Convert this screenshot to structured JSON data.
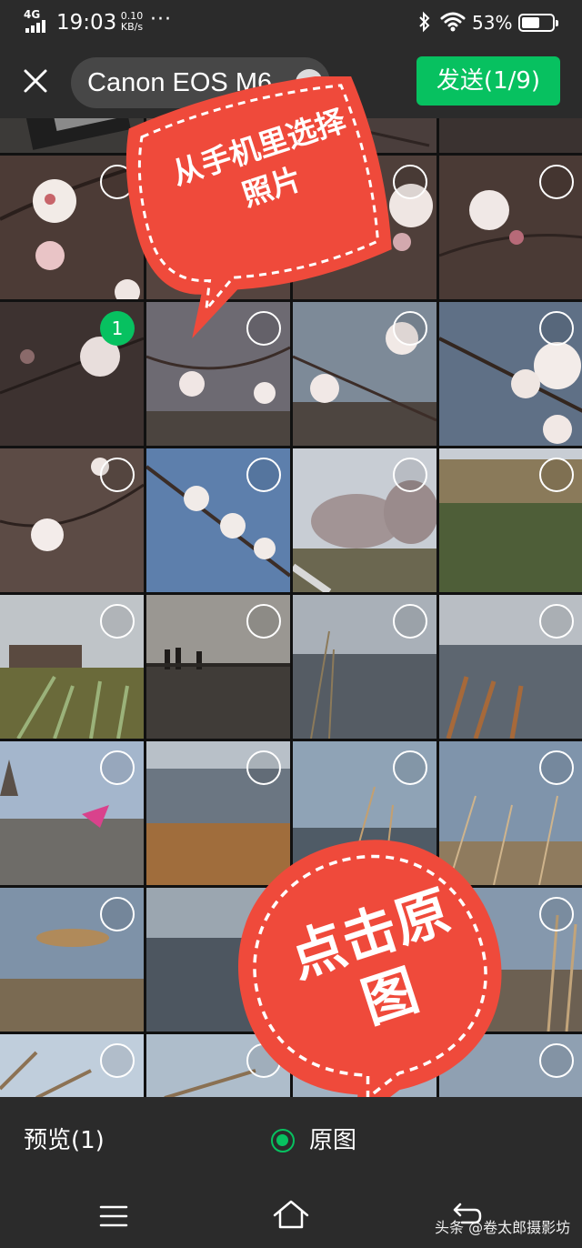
{
  "status_bar": {
    "network": "4G",
    "time": "19:03",
    "speed_value": "0.10",
    "speed_unit": "KB/s",
    "more": "···",
    "battery_percent": "53%",
    "icons": [
      "signal-icon",
      "bluetooth-icon",
      "wifi-icon",
      "battery-icon"
    ]
  },
  "header": {
    "close_icon": "close-icon",
    "album_name": "Canon EOS M6",
    "album_toggle_icon": "chevron-up-icon",
    "send_label": "发送(1/9)"
  },
  "grid": {
    "selected_badge": "1"
  },
  "stickers": {
    "top_text": "从手机里选择照片",
    "bottom_text": "点击原图"
  },
  "bottom_bar": {
    "preview_label": "预览(1)",
    "original_label": "原图",
    "original_checked": true
  },
  "nav_bar": {
    "icons": [
      "menu-icon",
      "home-icon",
      "back-icon"
    ],
    "watermark": "头条 @卷太郎摄影坊"
  },
  "colors": {
    "accent": "#07c160",
    "bar_bg": "#2b2b2b",
    "sticker_red": "#ef4a3b"
  }
}
